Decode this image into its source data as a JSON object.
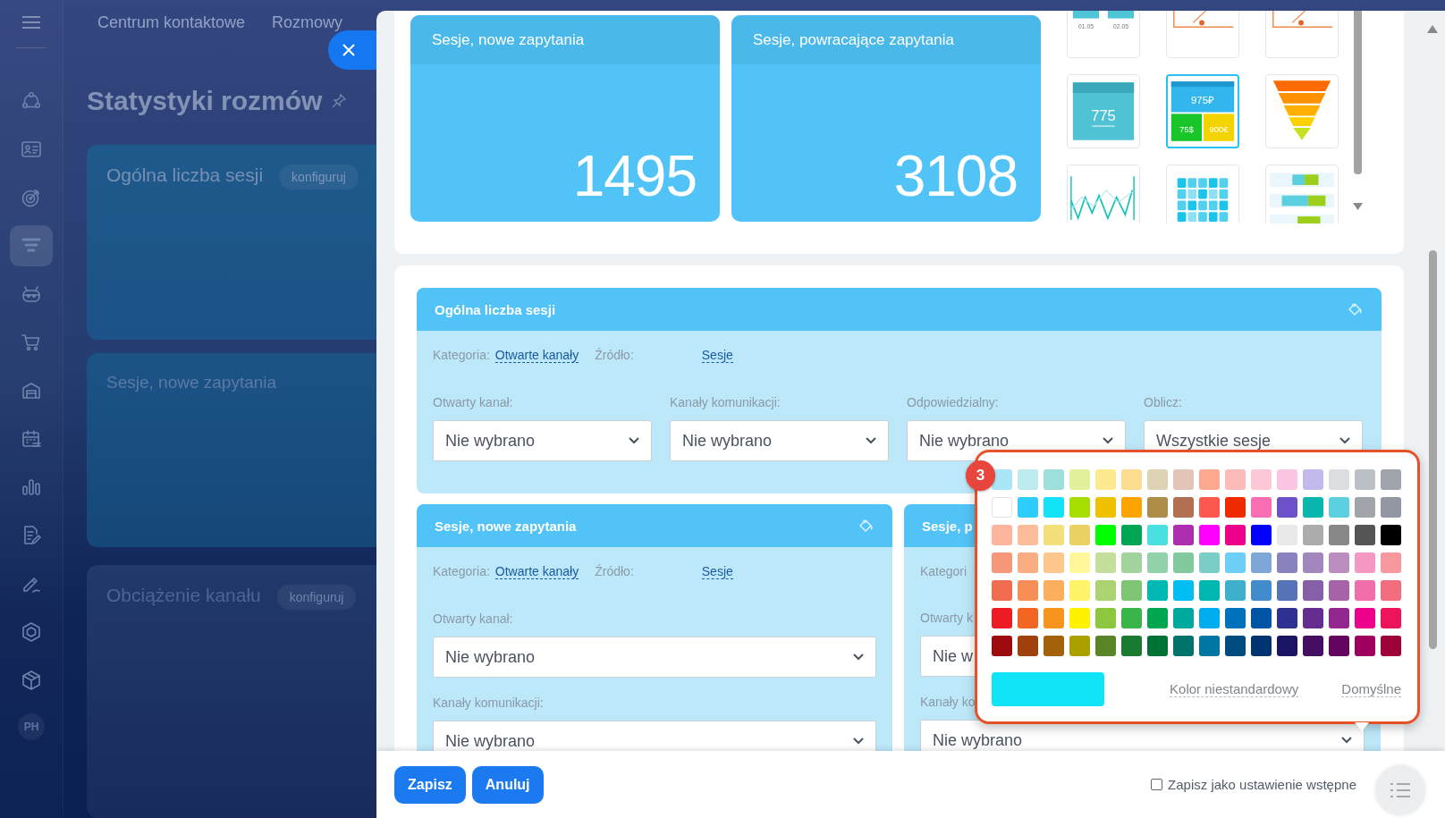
{
  "sidebar": {
    "items": [
      {
        "kind": "connections",
        "selected": false
      },
      {
        "kind": "contact-card",
        "selected": false
      },
      {
        "kind": "target",
        "selected": false
      },
      {
        "kind": "funnel",
        "selected": true
      },
      {
        "kind": "robot",
        "selected": false
      },
      {
        "kind": "cart",
        "selected": false
      },
      {
        "kind": "warehouse",
        "selected": false
      },
      {
        "kind": "calendar",
        "selected": false
      },
      {
        "kind": "bar-chart",
        "selected": false
      },
      {
        "kind": "document",
        "selected": false
      },
      {
        "kind": "pen",
        "selected": false
      },
      {
        "kind": "hexagon",
        "selected": false
      },
      {
        "kind": "cube",
        "selected": false
      }
    ],
    "avatar": "PH"
  },
  "header": {
    "tabs": [
      {
        "label": "Centrum kontaktowe"
      },
      {
        "label": "Rozmowy"
      }
    ]
  },
  "page": {
    "title": "Statystyki rozmów",
    "cards": [
      {
        "title": "Ogólna liczba sesji",
        "button": "konfiguruj"
      },
      {
        "title": "Sesje, nowe zapytania"
      },
      {
        "title": "Obciążenie kanału",
        "button": "konfiguruj"
      }
    ]
  },
  "panel": {
    "widgets": [
      {
        "title": "Sesje, nowe zapytania",
        "value": "1495"
      },
      {
        "title": "Sesje, powracające zapytania",
        "value": "3108"
      }
    ],
    "widget_types": [
      {
        "kind": "bar",
        "labels": [
          "01.05",
          "02.05"
        ],
        "selected": false
      },
      {
        "kind": "line-marker",
        "selected": false
      },
      {
        "kind": "line-marker",
        "selected": false
      },
      {
        "kind": "number",
        "labels": [
          "775"
        ],
        "selected": false
      },
      {
        "kind": "number-grid",
        "labels": [
          "975₽",
          "75$",
          "900€"
        ],
        "selected": true
      },
      {
        "kind": "funnel",
        "selected": false
      },
      {
        "kind": "line",
        "selected": false
      },
      {
        "kind": "heatmap",
        "selected": false
      },
      {
        "kind": "gantt",
        "selected": false
      }
    ],
    "blocks": [
      {
        "kind": "row",
        "title": "Ogólna liczba sesji",
        "category_label": "Kategoria:",
        "category": "Otwarte kanały",
        "source_label": "Źródło:",
        "source": "Sesje",
        "fields": [
          {
            "label": "Otwarty kanał:",
            "value": "Nie wybrano"
          },
          {
            "label": "Kanały komunikacji:",
            "value": "Nie wybrano"
          },
          {
            "label": "Odpowiedzialny:",
            "value": "Nie wybrano"
          },
          {
            "label": "Oblicz:",
            "value": "Wszystkie sesje"
          }
        ]
      },
      {
        "kind": "column",
        "title": "Sesje, nowe zapytania",
        "category_label": "Kategoria:",
        "category": "Otwarte kanały",
        "source_label": "Źródło:",
        "source": "Sesje",
        "fields": [
          {
            "label": "Otwarty kanał:",
            "value": "Nie wybrano"
          },
          {
            "label": "Kanały komunikacji:",
            "value": "Nie wybrano"
          }
        ]
      },
      {
        "kind": "column",
        "title": "Sesje, p",
        "category_label": "Kategori",
        "fields": [
          {
            "label": "Otwarty k",
            "value": "Nie w"
          },
          {
            "label": "Kanały ko",
            "value": "Nie wybrano"
          }
        ]
      }
    ],
    "footer": {
      "buttons": [
        "Zapisz",
        "Anuluj"
      ],
      "save_as_default": {
        "label": "Zapisz jako ustawienie wstępne",
        "checked": false
      }
    }
  },
  "color_picker": {
    "step": "3",
    "swatches": [
      {
        "color": "#a9e6f7"
      },
      {
        "color": "#bdeaee"
      },
      {
        "color": "#9de0db"
      },
      {
        "color": "#e2f09b"
      },
      {
        "color": "#fdea90"
      },
      {
        "color": "#fcdc8f"
      },
      {
        "color": "#dfd3b6"
      },
      {
        "color": "#e2c4b9"
      },
      {
        "color": "#fca98f"
      },
      {
        "color": "#fbbbb9"
      },
      {
        "color": "#fdc9d7"
      },
      {
        "color": "#fbc4e3"
      },
      {
        "color": "#c4b9ec"
      },
      {
        "color": "#dcdde1"
      },
      {
        "color": "#bbc0c7"
      },
      {
        "color": "#a0a5ad"
      },
      {
        "color": "#ffffff"
      },
      {
        "color": "#2fcdfc"
      },
      {
        "color": "#12e3f9"
      },
      {
        "color": "#a6de00"
      },
      {
        "color": "#eec200"
      },
      {
        "color": "#fea400"
      },
      {
        "color": "#ae8d48"
      },
      {
        "color": "#b26f52"
      },
      {
        "color": "#fd584f"
      },
      {
        "color": "#f02b00"
      },
      {
        "color": "#f96db3"
      },
      {
        "color": "#6b52c8"
      },
      {
        "color": "#0ab6ad"
      },
      {
        "color": "#5dd0e0"
      },
      {
        "color": "#a1a5ab"
      },
      {
        "color": "#9397a3"
      },
      {
        "color": "#feb59e"
      },
      {
        "color": "#fdbd9b"
      },
      {
        "color": "#f3e07c"
      },
      {
        "color": "#e9d263"
      },
      {
        "color": "#00ff00"
      },
      {
        "color": "#00a651"
      },
      {
        "color": "#48e0e0"
      },
      {
        "color": "#ad2faf"
      },
      {
        "color": "#ff00ff"
      },
      {
        "color": "#ec008c"
      },
      {
        "color": "#0000ff"
      },
      {
        "color": "#e9e9e9"
      },
      {
        "color": "#acacac"
      },
      {
        "color": "#888888"
      },
      {
        "color": "#555555"
      },
      {
        "color": "#000000"
      },
      {
        "color": "#f7977a"
      },
      {
        "color": "#f9ad81"
      },
      {
        "color": "#fdc68a"
      },
      {
        "color": "#fff79a"
      },
      {
        "color": "#c4df9b"
      },
      {
        "color": "#a3d39c"
      },
      {
        "color": "#92d2aa"
      },
      {
        "color": "#82ca9d"
      },
      {
        "color": "#7bcdc8"
      },
      {
        "color": "#6ecff6"
      },
      {
        "color": "#7ea7d8"
      },
      {
        "color": "#8882be"
      },
      {
        "color": "#a187be"
      },
      {
        "color": "#bc8dbf"
      },
      {
        "color": "#f49ac2"
      },
      {
        "color": "#f6989d"
      },
      {
        "color": "#f26c4f"
      },
      {
        "color": "#f68e55"
      },
      {
        "color": "#fbaf5c"
      },
      {
        "color": "#fff467"
      },
      {
        "color": "#acd372"
      },
      {
        "color": "#7dc473"
      },
      {
        "color": "#00b9b4"
      },
      {
        "color": "#00bdf2"
      },
      {
        "color": "#00b8b0"
      },
      {
        "color": "#3fb0cb"
      },
      {
        "color": "#438ccb"
      },
      {
        "color": "#5573b7"
      },
      {
        "color": "#855fa8"
      },
      {
        "color": "#a763a8"
      },
      {
        "color": "#f06eaa"
      },
      {
        "color": "#f26d7d"
      },
      {
        "color": "#ed1c24"
      },
      {
        "color": "#f26522"
      },
      {
        "color": "#f7941d"
      },
      {
        "color": "#fff200"
      },
      {
        "color": "#8dc73f"
      },
      {
        "color": "#39b54a"
      },
      {
        "color": "#00a650"
      },
      {
        "color": "#00a99d"
      },
      {
        "color": "#00aeef"
      },
      {
        "color": "#0072bc"
      },
      {
        "color": "#0054a6"
      },
      {
        "color": "#2e3192"
      },
      {
        "color": "#662d91"
      },
      {
        "color": "#92278f"
      },
      {
        "color": "#ec008c"
      },
      {
        "color": "#ed145b"
      },
      {
        "color": "#9e0b0f"
      },
      {
        "color": "#a0410d"
      },
      {
        "color": "#a36209"
      },
      {
        "color": "#aba000"
      },
      {
        "color": "#598527"
      },
      {
        "color": "#1a7b30"
      },
      {
        "color": "#007236"
      },
      {
        "color": "#00746b"
      },
      {
        "color": "#0076a3"
      },
      {
        "color": "#004b80"
      },
      {
        "color": "#003471"
      },
      {
        "color": "#1b1464"
      },
      {
        "color": "#440e62"
      },
      {
        "color": "#630460"
      },
      {
        "color": "#9e005d"
      },
      {
        "color": "#9e0039"
      }
    ],
    "current": {
      "color": "#12e4f8"
    },
    "custom_link": "Kolor niestandardowy",
    "default_link": "Domyślne"
  }
}
